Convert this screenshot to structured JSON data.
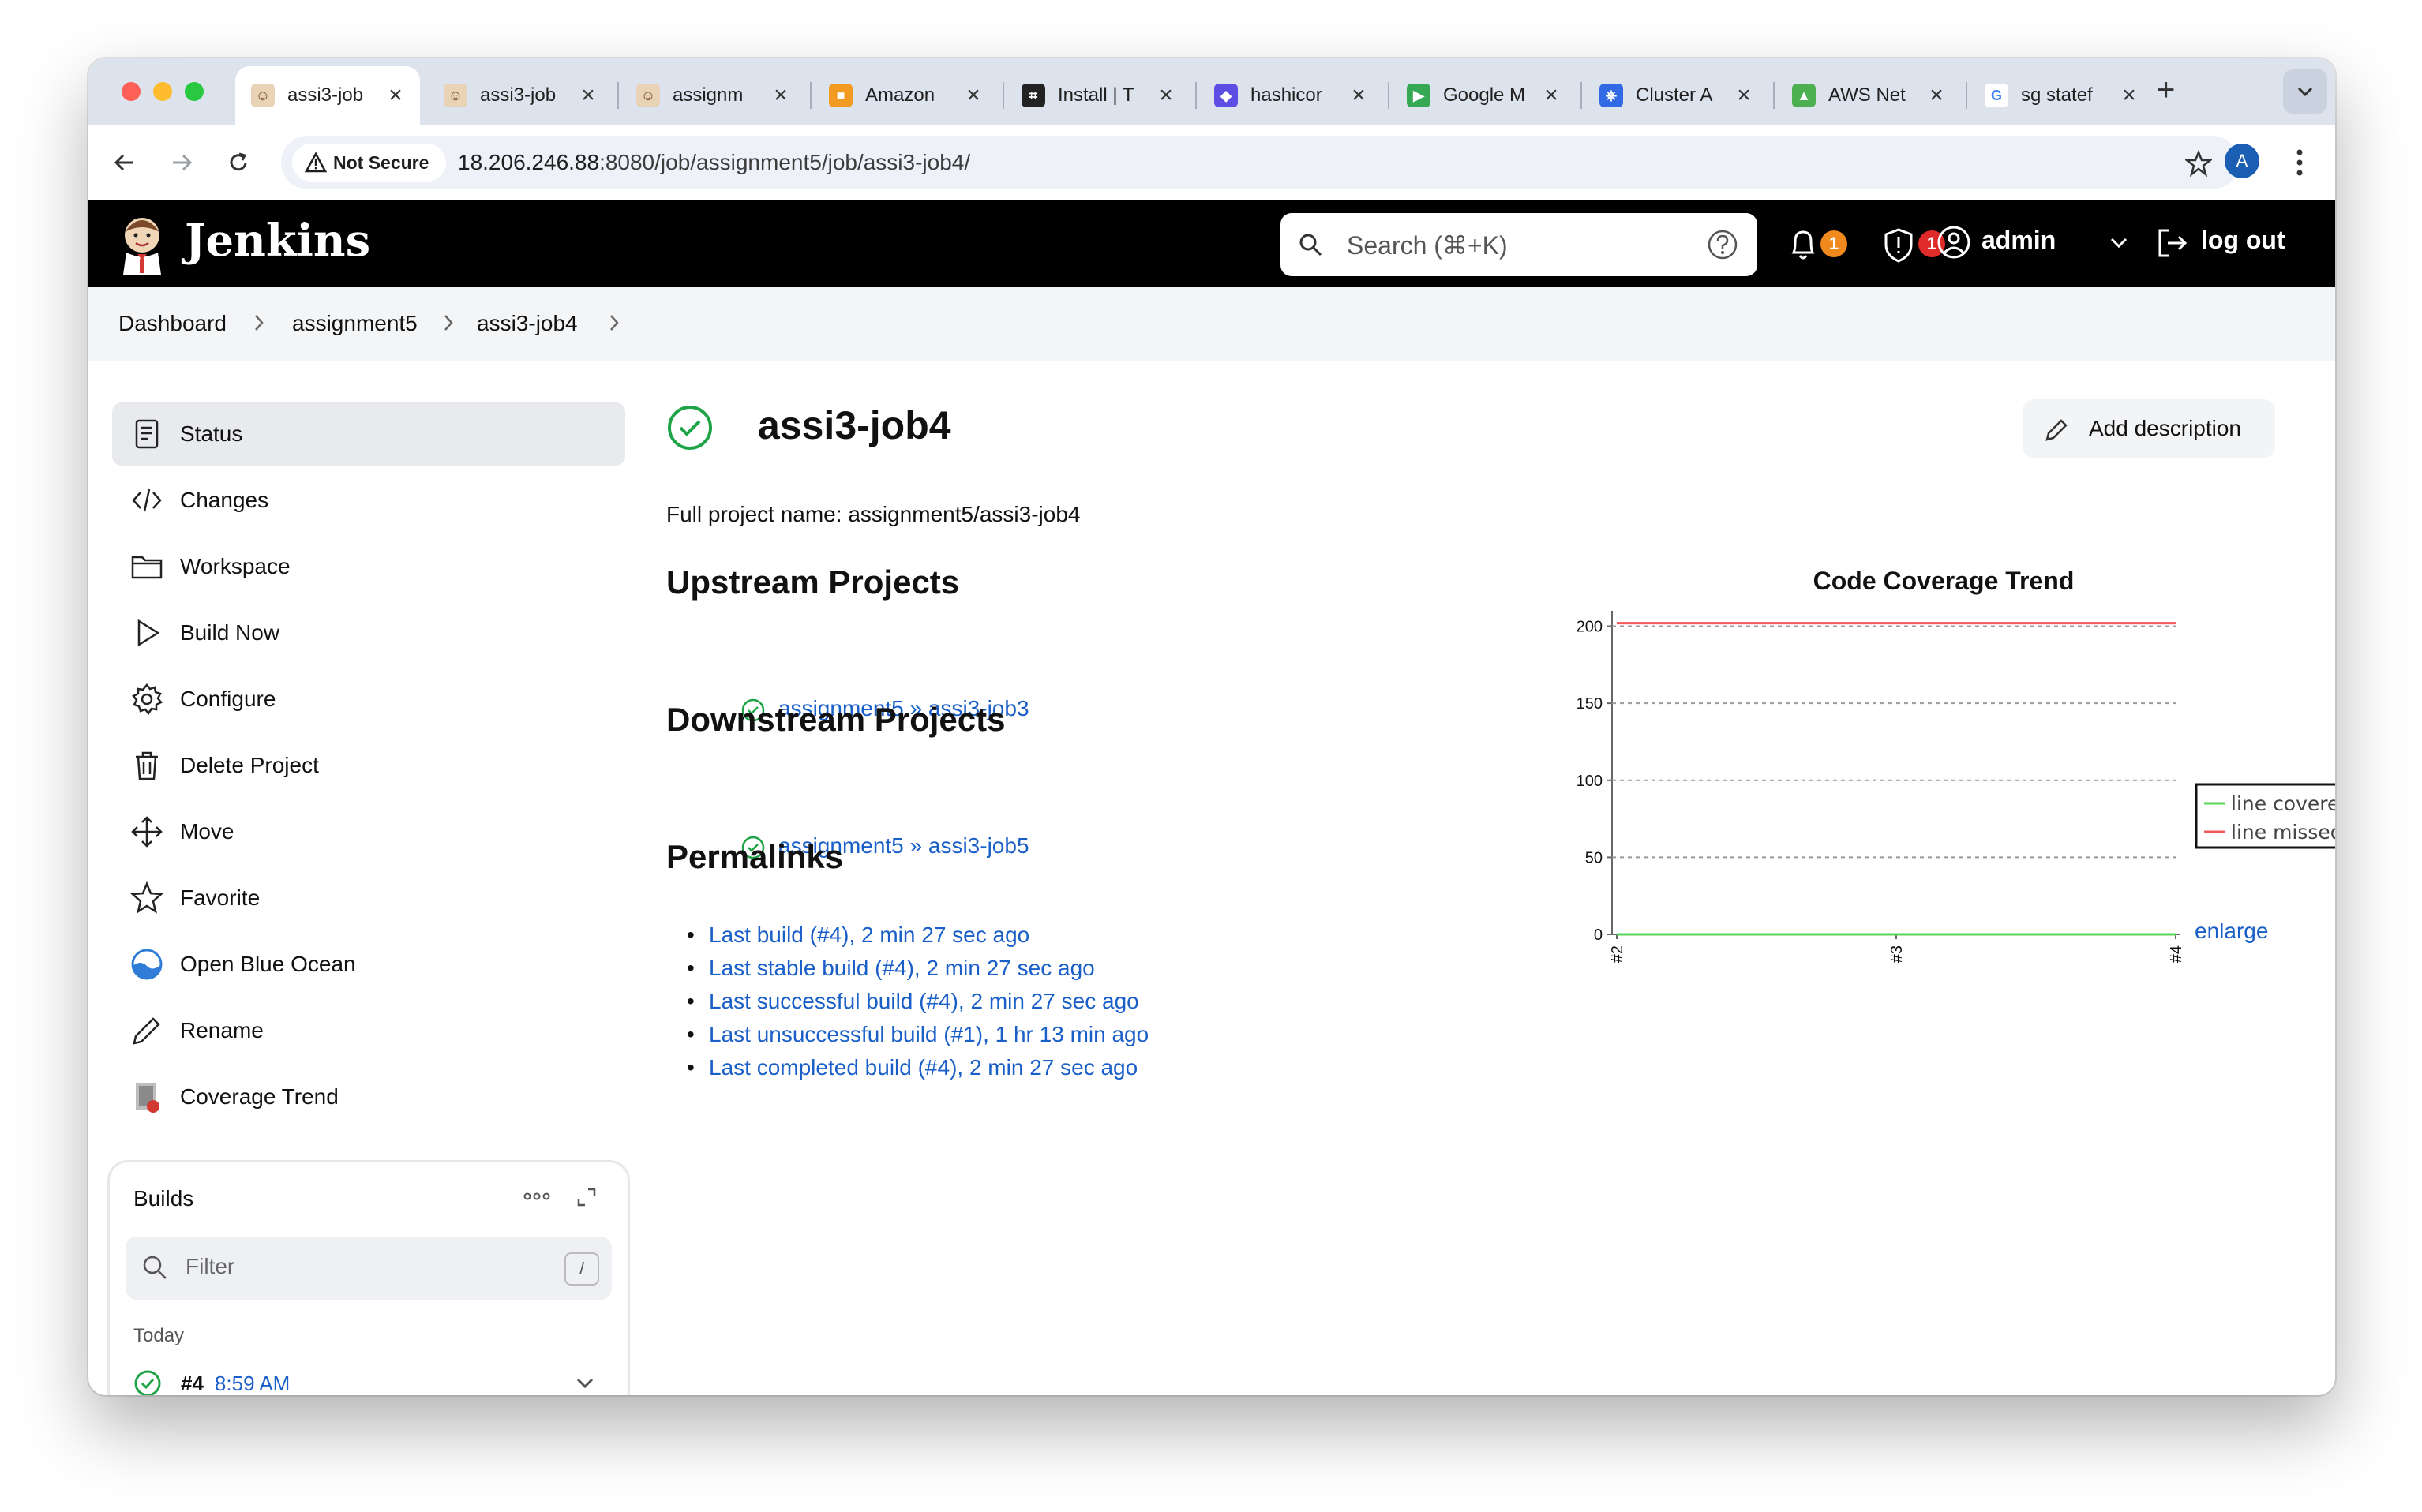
{
  "browser": {
    "tabs": [
      {
        "label": "assi3-job",
        "active": true
      },
      {
        "label": "assi3-job",
        "active": false
      },
      {
        "label": "assignm",
        "active": false
      },
      {
        "label": "Amazon",
        "active": false
      },
      {
        "label": "Install | T",
        "active": false
      },
      {
        "label": "hashicor",
        "active": false
      },
      {
        "label": "Google M",
        "active": false
      },
      {
        "label": "Cluster A",
        "active": false
      },
      {
        "label": "AWS Net",
        "active": false
      },
      {
        "label": "sg statef",
        "active": false
      }
    ],
    "not_secure_label": "Not Secure",
    "url_host": "18.206.246.88",
    "url_rest": ":8080/job/assignment5/job/assi3-job4/",
    "profile_initial": "A"
  },
  "header": {
    "app_name": "Jenkins",
    "search_placeholder": "Search (⌘+K)",
    "notifications_count": "1",
    "security_count": "1",
    "user": "admin",
    "logout": "log out"
  },
  "breadcrumb": [
    "Dashboard",
    "assignment5",
    "assi3-job4"
  ],
  "sidebar": {
    "items": [
      {
        "label": "Status",
        "icon": "document-icon",
        "active": true
      },
      {
        "label": "Changes",
        "icon": "code-icon"
      },
      {
        "label": "Workspace",
        "icon": "folder-icon"
      },
      {
        "label": "Build Now",
        "icon": "play-icon"
      },
      {
        "label": "Configure",
        "icon": "gear-icon"
      },
      {
        "label": "Delete Project",
        "icon": "trash-icon"
      },
      {
        "label": "Move",
        "icon": "move-icon"
      },
      {
        "label": "Favorite",
        "icon": "star-icon"
      },
      {
        "label": "Open Blue Ocean",
        "icon": "blue-ocean-icon"
      },
      {
        "label": "Rename",
        "icon": "pencil-icon"
      },
      {
        "label": "Coverage Trend",
        "icon": "coverage-icon"
      }
    ],
    "builds": {
      "title": "Builds",
      "filter_placeholder": "Filter",
      "filter_shortcut": "/",
      "group_label": "Today",
      "items": [
        {
          "number": "#4",
          "time": "8:59 AM",
          "status": "success"
        }
      ]
    }
  },
  "main": {
    "title": "assi3-job4",
    "add_description": "Add description",
    "full_name_label": "Full project name: assignment5/assi3-job4",
    "upstream_heading": "Upstream Projects",
    "upstream": [
      "assignment5 » assi3-job3"
    ],
    "downstream_heading": "Downstream Projects",
    "downstream": [
      "assignment5 » assi3-job5"
    ],
    "permalinks_heading": "Permalinks",
    "permalinks": [
      "Last build (#4), 2 min 27 sec ago",
      "Last stable build (#4), 2 min 27 sec ago",
      "Last successful build (#4), 2 min 27 sec ago",
      "Last unsuccessful build (#1), 1 hr 13 min ago",
      "Last completed build (#4), 2 min 27 sec ago"
    ],
    "enlarge": "enlarge"
  },
  "colors": {
    "link": "#1a5fc8",
    "success": "#1ea446",
    "badge_orange": "#f08a1c",
    "badge_red": "#e02b2b"
  },
  "chart_data": {
    "type": "line",
    "title": "Code Coverage Trend",
    "categories": [
      "#2",
      "#3",
      "#4"
    ],
    "series": [
      {
        "name": "line covered",
        "color": "#5ad65a",
        "values": [
          0,
          0,
          0
        ]
      },
      {
        "name": "line missed",
        "color": "#f15a5a",
        "values": [
          202,
          202,
          202
        ]
      }
    ],
    "yticks": [
      0,
      50,
      100,
      150,
      200
    ],
    "ylim": [
      0,
      210
    ],
    "grid": true,
    "legend": "right"
  }
}
